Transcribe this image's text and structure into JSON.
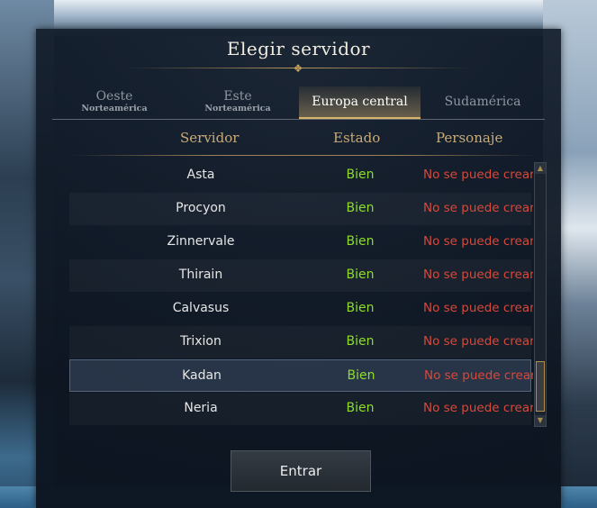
{
  "dialog": {
    "title": "Elegir servidor"
  },
  "tabs": [
    {
      "label": "Oeste",
      "sublabel": "Norteamérica"
    },
    {
      "label": "Este",
      "sublabel": "Norteamérica"
    },
    {
      "label": "Europa central",
      "sublabel": "",
      "active": true
    },
    {
      "label": "Sudamérica",
      "sublabel": ""
    }
  ],
  "columns": {
    "server": "Servidor",
    "status": "Estado",
    "character": "Personaje"
  },
  "servers": [
    {
      "name": "Asta",
      "status": "Bien",
      "character": "No se puede crear"
    },
    {
      "name": "Procyon",
      "status": "Bien",
      "character": "No se puede crear"
    },
    {
      "name": "Zinnervale",
      "status": "Bien",
      "character": "No se puede crear"
    },
    {
      "name": "Thirain",
      "status": "Bien",
      "character": "No se puede crear"
    },
    {
      "name": "Calvasus",
      "status": "Bien",
      "character": "No se puede crear"
    },
    {
      "name": "Trixion",
      "status": "Bien",
      "character": "No se puede crear"
    },
    {
      "name": "Kadan",
      "status": "Bien",
      "character": "No se puede crear",
      "selected": true
    },
    {
      "name": "Neria",
      "status": "Bien",
      "character": "No se puede crear"
    }
  ],
  "enter_button": "Entrar",
  "colors": {
    "status_good": "#8fdc2a",
    "character_unavailable": "#d8493a",
    "header_gold": "#c9ab78",
    "tab_active_underline": "#d8b36a"
  }
}
